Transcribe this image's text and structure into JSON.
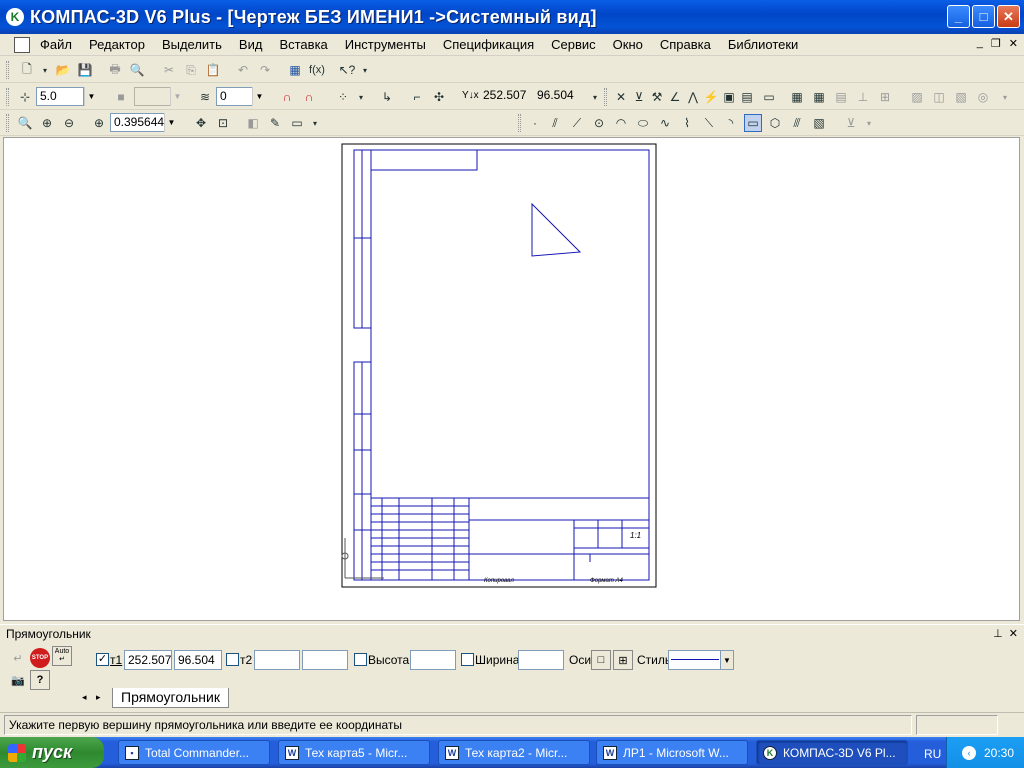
{
  "window": {
    "title": "КОМПАС-3D V6 Plus - [Чертеж БЕЗ ИМЕНИ1 ->Системный вид]",
    "app_icon": "kompas-logo-icon"
  },
  "menu": [
    {
      "label": "Файл"
    },
    {
      "label": "Редактор"
    },
    {
      "label": "Выделить"
    },
    {
      "label": "Вид"
    },
    {
      "label": "Вставка"
    },
    {
      "label": "Инструменты"
    },
    {
      "label": "Спецификация"
    },
    {
      "label": "Сервис"
    },
    {
      "label": "Окно"
    },
    {
      "label": "Справка"
    },
    {
      "label": "Библиотеки"
    }
  ],
  "toolbar2": {
    "step_value": "5.0",
    "layer_value": "0",
    "coord_x": "252.507",
    "coord_y": "96.504"
  },
  "toolbar3": {
    "zoom_value": "0.395644"
  },
  "properties": {
    "panel_title": "Прямоугольник",
    "t1_label": "т1",
    "t1_x": "252.507",
    "t1_y": "96.504",
    "t2_label": "т2",
    "t2_x": "",
    "t2_y": "",
    "height_label": "Высота",
    "height_value": "",
    "width_label": "Ширина",
    "width_value": "",
    "axes_label": "Оси",
    "style_label": "Стиль",
    "tab_label": "Прямоугольник",
    "auto_label": "Auto",
    "stop_label": "STOP"
  },
  "status": {
    "text": "Укажите первую вершину прямоугольника или введите ее координаты"
  },
  "drawing": {
    "title_block_sheet": "1:1",
    "label_format": "Формат  А4",
    "label_copied": "Копировал"
  },
  "taskbar": {
    "start_label": "пуск",
    "tasks": [
      {
        "label": "Total Commander..."
      },
      {
        "label": "Тех карта5 - Micr..."
      },
      {
        "label": "Тех карта2 - Micr..."
      },
      {
        "label": "ЛР1 - Microsoft W..."
      },
      {
        "label": "КОМПАС-3D V6 Pl..."
      }
    ],
    "lang": "RU",
    "clock": "20:30"
  }
}
